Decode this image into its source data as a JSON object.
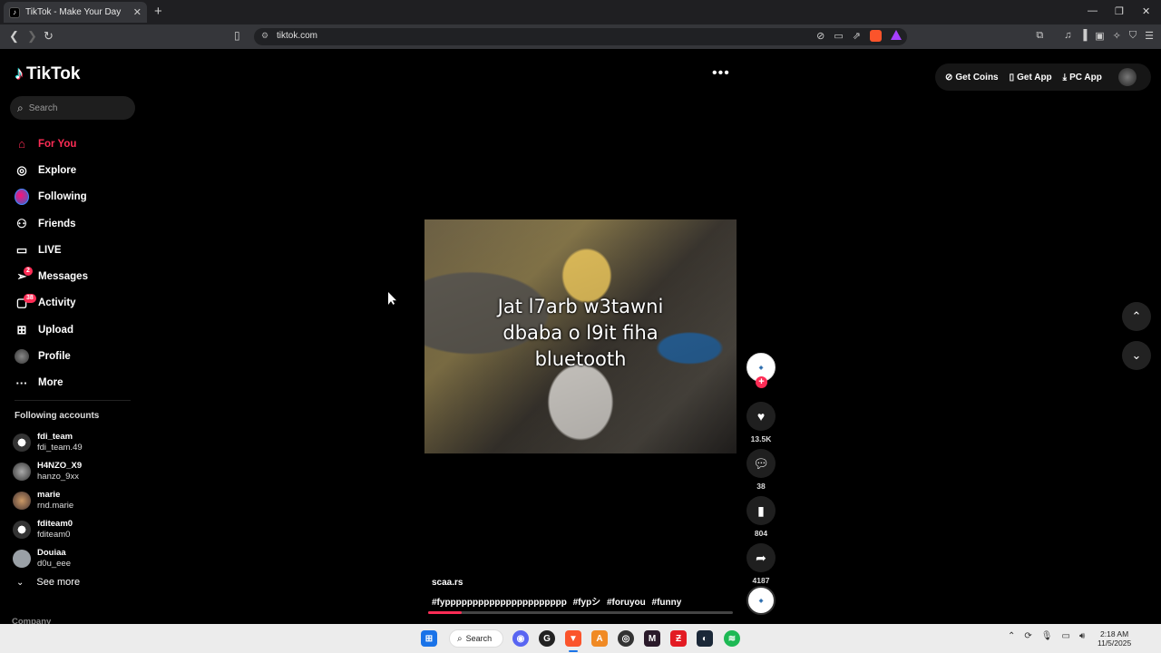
{
  "browser": {
    "tab_title": "TikTok - Make Your Day",
    "url": "tiktok.com"
  },
  "sidebar": {
    "logo": "TikTok",
    "search_placeholder": "Search",
    "nav": [
      {
        "label": "For You",
        "icon": "home-icon",
        "active": true
      },
      {
        "label": "Explore",
        "icon": "compass-icon"
      },
      {
        "label": "Following",
        "icon": "following-avatar-icon"
      },
      {
        "label": "Friends",
        "icon": "friends-icon"
      },
      {
        "label": "LIVE",
        "icon": "live-icon"
      },
      {
        "label": "Messages",
        "icon": "messages-icon",
        "badge": "2"
      },
      {
        "label": "Activity",
        "icon": "activity-icon",
        "badge": "38"
      },
      {
        "label": "Upload",
        "icon": "upload-icon"
      },
      {
        "label": "Profile",
        "icon": "profile-avatar-icon"
      },
      {
        "label": "More",
        "icon": "more-icon"
      }
    ],
    "following_title": "Following accounts",
    "accounts": [
      {
        "name": "fdi_team",
        "handle": "fdi_team.49"
      },
      {
        "name": "H4NZO_X9",
        "handle": "hanzo_9xx"
      },
      {
        "name": "marie",
        "handle": "rnd.marie"
      },
      {
        "name": "fditeam0",
        "handle": "fditeam0"
      },
      {
        "name": "Douiaa",
        "handle": "d0u_eee"
      }
    ],
    "see_more": "See more",
    "company": "Company"
  },
  "video": {
    "caption_lines": [
      "Jat l7arb w3tawni",
      "dbaba o l9it fiha",
      "bluetooth"
    ],
    "author": "scaa.rs",
    "hashtags": [
      "#fypppppppppppppppppppppp",
      "#fypシ",
      "#foruyou",
      "#funny"
    ],
    "progress": 0.11
  },
  "actions": {
    "likes": "13.5K",
    "comments": "38",
    "saves": "804",
    "shares": "4187"
  },
  "topbar": {
    "get_coins": "Get Coins",
    "get_app": "Get App",
    "pc_app": "PC App"
  },
  "taskbar": {
    "search": "Search",
    "time": "2:18 AM",
    "date": "11/5/2025"
  },
  "colors": {
    "accent": "#fe2c55",
    "background": "#000000"
  }
}
